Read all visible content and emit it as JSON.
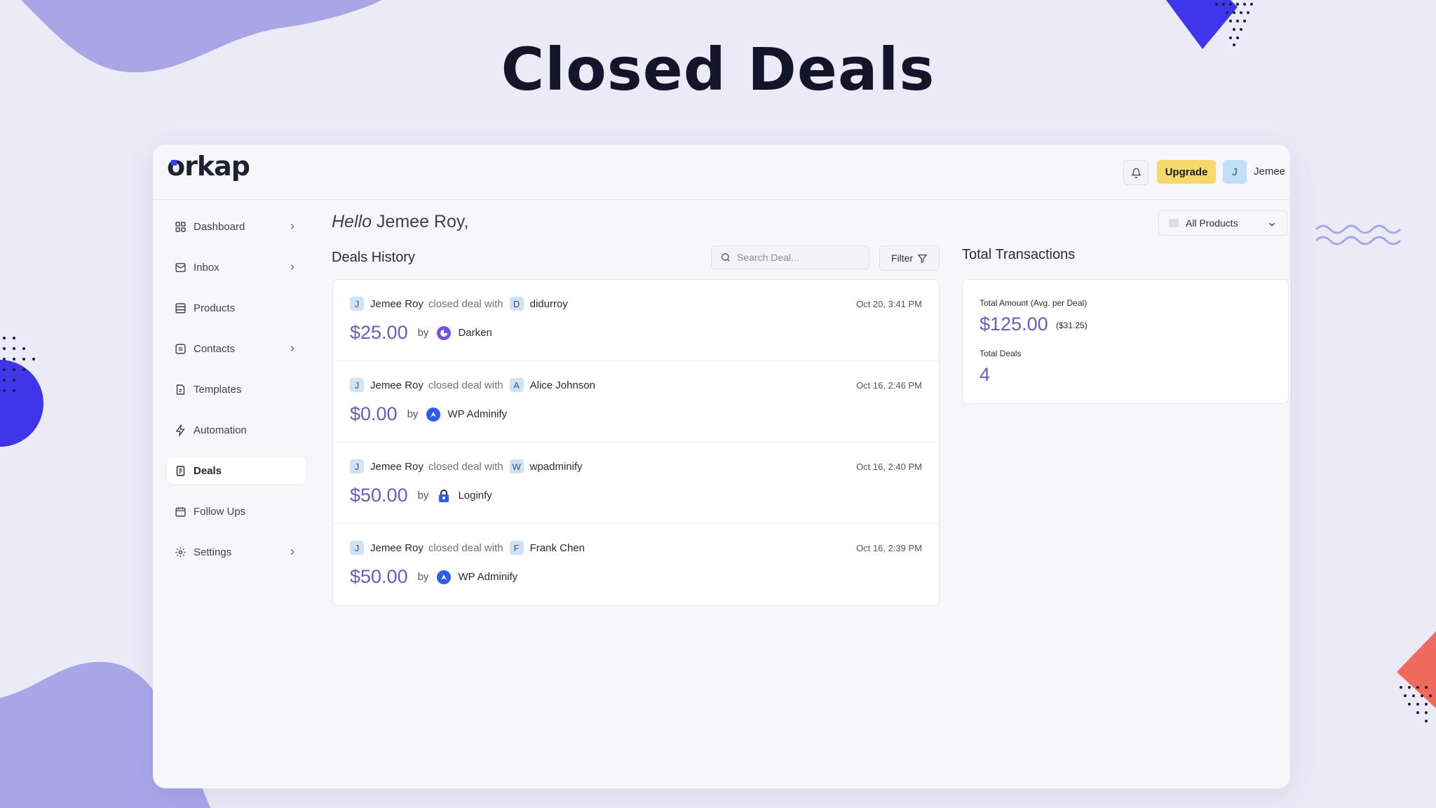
{
  "page": {
    "heading": "Closed Deals"
  },
  "brand": {
    "logo_text": "orkap",
    "accent": "#6a5bbd",
    "primary_blue": "#3b3bf0",
    "upgrade_bg": "#f5d96b"
  },
  "header": {
    "upgrade_label": "Upgrade",
    "user_initial": "J",
    "user_name": "Jemee"
  },
  "sidebar": {
    "items": [
      {
        "label": "Dashboard",
        "icon": "grid-icon",
        "has_chevron": true
      },
      {
        "label": "Inbox",
        "icon": "inbox-icon",
        "has_chevron": true
      },
      {
        "label": "Products",
        "icon": "box-icon",
        "has_chevron": false
      },
      {
        "label": "Contacts",
        "icon": "contacts-icon",
        "has_chevron": true
      },
      {
        "label": "Templates",
        "icon": "template-icon",
        "has_chevron": false
      },
      {
        "label": "Automation",
        "icon": "bolt-icon",
        "has_chevron": false
      },
      {
        "label": "Deals",
        "icon": "document-icon",
        "has_chevron": false,
        "active": true
      },
      {
        "label": "Follow Ups",
        "icon": "calendar-icon",
        "has_chevron": false
      },
      {
        "label": "Settings",
        "icon": "gear-icon",
        "has_chevron": true
      }
    ]
  },
  "main": {
    "greeting_prefix": "Hello",
    "greeting_name": "Jemee Roy,",
    "deals_title": "Deals History",
    "search_placeholder": "Search Deal...",
    "filter_label": "Filter",
    "closed_text": "closed deal with",
    "by_text": "by",
    "deals": [
      {
        "closer_initial": "J",
        "closer": "Jemee Roy",
        "target_initial": "D",
        "target": "didurroy",
        "time": "Oct 20, 3:41 PM",
        "amount": "$25.00",
        "product": "Darken",
        "product_icon": "darken-icon"
      },
      {
        "closer_initial": "J",
        "closer": "Jemee Roy",
        "target_initial": "A",
        "target": "Alice Johnson",
        "time": "Oct 16, 2:46 PM",
        "amount": "$0.00",
        "product": "WP Adminify",
        "product_icon": "adminify-icon"
      },
      {
        "closer_initial": "J",
        "closer": "Jemee Roy",
        "target_initial": "W",
        "target": "wpadminify",
        "time": "Oct 16, 2:40 PM",
        "amount": "$50.00",
        "product": "Loginfy",
        "product_icon": "lock-icon"
      },
      {
        "closer_initial": "J",
        "closer": "Jemee Roy",
        "target_initial": "F",
        "target": "Frank Chen",
        "time": "Oct 16, 2:39 PM",
        "amount": "$50.00",
        "product": "WP Adminify",
        "product_icon": "adminify-icon"
      }
    ]
  },
  "totals": {
    "products_select": "All Products",
    "title": "Total Transactions",
    "amount_label": "Total Amount (Avg. per Deal)",
    "amount_value": "$125.00",
    "avg_value": "($31.25)",
    "deals_label": "Total Deals",
    "deals_value": "4"
  }
}
